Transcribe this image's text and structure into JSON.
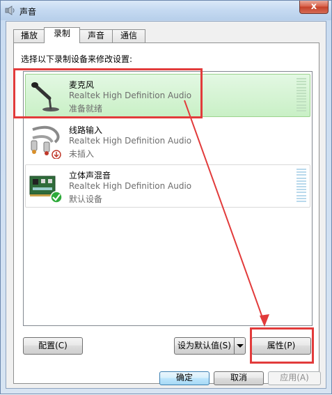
{
  "window": {
    "title": "声音",
    "close_glyph": "x"
  },
  "tabs": [
    {
      "label": "播放"
    },
    {
      "label": "录制"
    },
    {
      "label": "声音"
    },
    {
      "label": "通信"
    }
  ],
  "instruction": "选择以下录制设备来修改设置:",
  "devices": [
    {
      "name": "麦克风",
      "driver": "Realtek High Definition Audio",
      "status": "准备就绪",
      "icon": "microphone-icon"
    },
    {
      "name": "线路输入",
      "driver": "Realtek High Definition Audio",
      "status": "未插入",
      "icon": "line-in-cable-icon"
    },
    {
      "name": "立体声混音",
      "driver": "Realtek High Definition Audio",
      "status": "默认设备",
      "icon": "sound-card-icon"
    }
  ],
  "buttons": {
    "configure": "配置(C)",
    "set_default": "设为默认值(S)",
    "properties": "属性(P)",
    "ok": "确定",
    "cancel": "取消",
    "apply": "应用(A)"
  },
  "colors": {
    "annotation": "#e23b3b",
    "selected_bg": "#c9f0c6"
  }
}
